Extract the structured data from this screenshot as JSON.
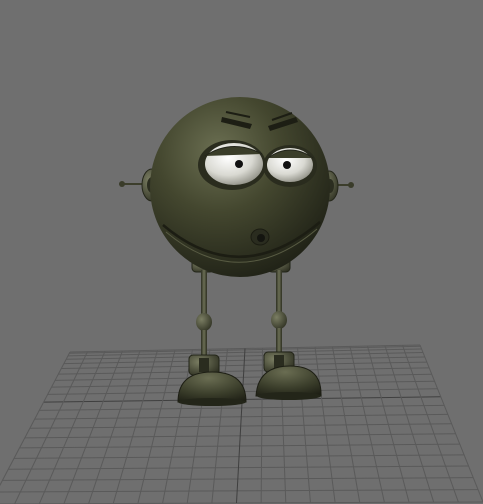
{
  "viewport": {
    "background_color": "#6f6f6f",
    "grid_color": "#5a5a5a",
    "grid_major_color": "#3f3f3f",
    "character": {
      "description_color_body": "#3b3e2c",
      "highlight_color": "#6b6f52",
      "eye_white": "#e8e8e2"
    }
  }
}
